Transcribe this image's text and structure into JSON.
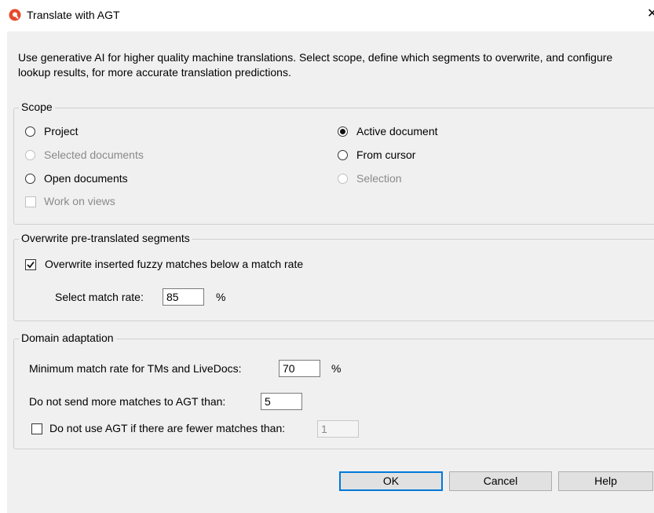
{
  "window": {
    "title": "Translate with AGT",
    "close_glyph": "✕"
  },
  "description": "Use generative AI for higher quality machine translations. Select scope, define which segments to overwrite, and configure lookup results, for more accurate translation predictions.",
  "scope": {
    "legend": "Scope",
    "project": "Project",
    "selected_documents": "Selected documents",
    "open_documents": "Open documents",
    "work_on_views": "Work on views",
    "active_document": "Active document",
    "from_cursor": "From cursor",
    "selection": "Selection",
    "selected": "active_document"
  },
  "overwrite": {
    "legend": "Overwrite pre-translated segments",
    "checkbox_label": "Overwrite inserted fuzzy matches below a match rate",
    "checked": true,
    "match_rate_label": "Select match rate:",
    "match_rate_value": "85",
    "percent": "%"
  },
  "domain": {
    "legend": "Domain adaptation",
    "min_rate_label": "Minimum match rate for TMs and LiveDocs:",
    "min_rate_value": "70",
    "percent": "%",
    "max_matches_label": "Do not send more matches to AGT than:",
    "max_matches_value": "5",
    "fewer_label": "Do not use AGT if there are fewer matches than:",
    "fewer_checked": false,
    "fewer_value": "1"
  },
  "buttons": {
    "ok": "OK",
    "cancel": "Cancel",
    "help": "Help"
  },
  "colors": {
    "accent": "#0078d7",
    "app_icon": "#e8492b"
  }
}
